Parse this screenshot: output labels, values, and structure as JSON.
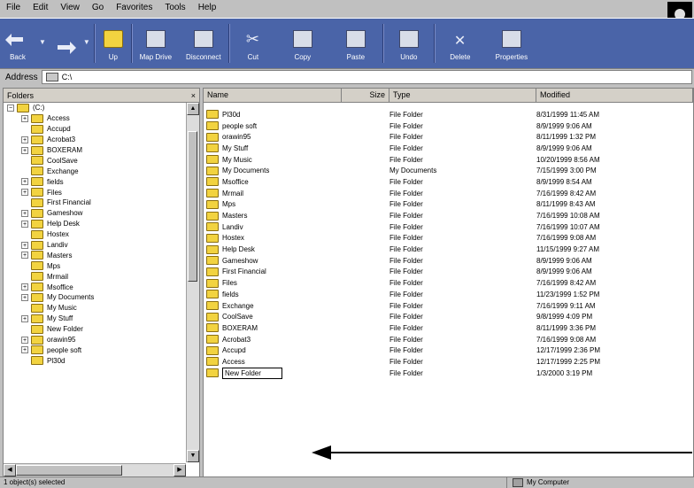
{
  "menu": [
    "File",
    "Edit",
    "View",
    "Go",
    "Favorites",
    "Tools",
    "Help"
  ],
  "toolbar": {
    "back": "Back",
    "up": "Up",
    "map_drive": "Map Drive",
    "disconnect": "Disconnect",
    "cut": "Cut",
    "copy": "Copy",
    "paste": "Paste",
    "undo": "Undo",
    "delete": "Delete",
    "properties": "Properties"
  },
  "address": {
    "label": "Address",
    "value": "C:\\"
  },
  "folders_pane": {
    "title": "Folders",
    "close": "×",
    "tree": [
      {
        "label": "(C:)",
        "indent": 0,
        "expander": "−"
      },
      {
        "label": "Access",
        "indent": 1,
        "expander": "+"
      },
      {
        "label": "Accupd",
        "indent": 1,
        "expander": ""
      },
      {
        "label": "Acrobat3",
        "indent": 1,
        "expander": "+"
      },
      {
        "label": "BOXERAM",
        "indent": 1,
        "expander": "+"
      },
      {
        "label": "CoolSave",
        "indent": 1,
        "expander": ""
      },
      {
        "label": "Exchange",
        "indent": 1,
        "expander": ""
      },
      {
        "label": "fields",
        "indent": 1,
        "expander": "+"
      },
      {
        "label": "Files",
        "indent": 1,
        "expander": "+"
      },
      {
        "label": "First Financial",
        "indent": 1,
        "expander": ""
      },
      {
        "label": "Gameshow",
        "indent": 1,
        "expander": "+"
      },
      {
        "label": "Help Desk",
        "indent": 1,
        "expander": "+"
      },
      {
        "label": "Hostex",
        "indent": 1,
        "expander": ""
      },
      {
        "label": "Landiv",
        "indent": 1,
        "expander": "+"
      },
      {
        "label": "Masters",
        "indent": 1,
        "expander": "+"
      },
      {
        "label": "Mps",
        "indent": 1,
        "expander": ""
      },
      {
        "label": "Mrmail",
        "indent": 1,
        "expander": ""
      },
      {
        "label": "Msoffice",
        "indent": 1,
        "expander": "+"
      },
      {
        "label": "My Documents",
        "indent": 1,
        "expander": "+"
      },
      {
        "label": "My Music",
        "indent": 1,
        "expander": ""
      },
      {
        "label": "My Stuff",
        "indent": 1,
        "expander": "+"
      },
      {
        "label": "New Folder",
        "indent": 1,
        "expander": ""
      },
      {
        "label": "orawin95",
        "indent": 1,
        "expander": "+"
      },
      {
        "label": "people soft",
        "indent": 1,
        "expander": "+"
      },
      {
        "label": "Pl30d",
        "indent": 1,
        "expander": ""
      }
    ]
  },
  "columns": {
    "name": "Name",
    "size": "Size",
    "type": "Type",
    "modified": "Modified"
  },
  "files": [
    {
      "name": "Pl30d",
      "type": "File Folder",
      "modified": "8/31/1999 11:45 AM"
    },
    {
      "name": "people soft",
      "type": "File Folder",
      "modified": "8/9/1999 9:06 AM"
    },
    {
      "name": "orawin95",
      "type": "File Folder",
      "modified": "8/11/1999 1:32 PM"
    },
    {
      "name": "My Stuff",
      "type": "File Folder",
      "modified": "8/9/1999 9:06 AM"
    },
    {
      "name": "My Music",
      "type": "File Folder",
      "modified": "10/20/1999 8:56 AM"
    },
    {
      "name": "My Documents",
      "type": "My Documents",
      "modified": "7/15/1999 3:00 PM"
    },
    {
      "name": "Msoffice",
      "type": "File Folder",
      "modified": "8/9/1999 8:54 AM"
    },
    {
      "name": "Mrmail",
      "type": "File Folder",
      "modified": "7/16/1999 8:42 AM"
    },
    {
      "name": "Mps",
      "type": "File Folder",
      "modified": "8/11/1999 8:43 AM"
    },
    {
      "name": "Masters",
      "type": "File Folder",
      "modified": "7/16/1999 10:08 AM"
    },
    {
      "name": "Landiv",
      "type": "File Folder",
      "modified": "7/16/1999 10:07 AM"
    },
    {
      "name": "Hostex",
      "type": "File Folder",
      "modified": "7/16/1999 9:08 AM"
    },
    {
      "name": "Help Desk",
      "type": "File Folder",
      "modified": "11/15/1999 9:27 AM"
    },
    {
      "name": "Gameshow",
      "type": "File Folder",
      "modified": "8/9/1999 9:06 AM"
    },
    {
      "name": "First Financial",
      "type": "File Folder",
      "modified": "8/9/1999 9:06 AM"
    },
    {
      "name": "Files",
      "type": "File Folder",
      "modified": "7/16/1999 8:42 AM"
    },
    {
      "name": "fields",
      "type": "File Folder",
      "modified": "11/23/1999 1:52 PM"
    },
    {
      "name": "Exchange",
      "type": "File Folder",
      "modified": "7/16/1999 9:11 AM"
    },
    {
      "name": "CoolSave",
      "type": "File Folder",
      "modified": "9/8/1999 4:09 PM"
    },
    {
      "name": "BOXERAM",
      "type": "File Folder",
      "modified": "8/11/1999 3:36 PM"
    },
    {
      "name": "Acrobat3",
      "type": "File Folder",
      "modified": "7/16/1999 9:08 AM"
    },
    {
      "name": "Accupd",
      "type": "File Folder",
      "modified": "12/17/1999 2:36 PM"
    },
    {
      "name": "Access",
      "type": "File Folder",
      "modified": "12/17/1999 2:25 PM"
    },
    {
      "name": "New Folder",
      "type": "File Folder",
      "modified": "1/3/2000 3:19 PM",
      "renaming": true
    }
  ],
  "status": {
    "left": "1 object(s) selected",
    "right": "My Computer"
  }
}
